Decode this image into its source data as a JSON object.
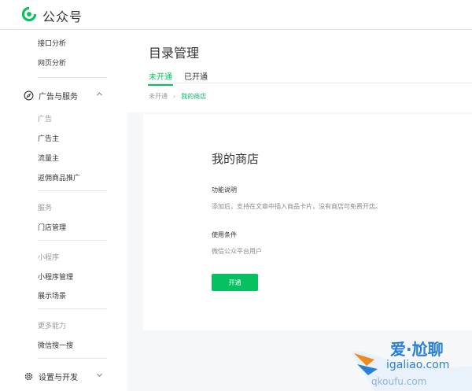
{
  "header": {
    "brand": "公众号"
  },
  "sidebar": {
    "top_items": [
      "接口分析",
      "网页分析"
    ],
    "group_ads": {
      "label": "广告与服务",
      "cat_ads": "广告",
      "ads_items": [
        "广告主",
        "流量主",
        "返佣商品推广"
      ],
      "cat_service": "服务",
      "service_items": [
        "门店管理"
      ],
      "cat_mini": "小程序",
      "mini_items": [
        "小程序管理",
        "展示场景"
      ],
      "cat_more": "更多能力",
      "more_items": [
        "微信搜一搜"
      ]
    },
    "group_settings": {
      "label": "设置与开发"
    }
  },
  "main": {
    "title": "目录管理",
    "tabs": [
      {
        "label": "未开通",
        "active": true
      },
      {
        "label": "已开通",
        "active": false
      }
    ],
    "breadcrumb": [
      "未开通",
      "我的商店"
    ],
    "card": {
      "title": "我的商店",
      "feature_label": "功能说明",
      "feature_text": "添加后，支持在文章中插入商品卡片，没有商店可免费开店。",
      "condition_label": "使用条件",
      "condition_text": "微信公众平台用户",
      "button_label": "开通"
    }
  },
  "watermark": {
    "line1": "爱·尬聊",
    "line2": "igaliao.com",
    "line3": "qkoufu.com"
  },
  "colors": {
    "accent": "#07c160",
    "text": "#353535",
    "muted": "#9a9a9a",
    "background": "#f6f7f9"
  }
}
